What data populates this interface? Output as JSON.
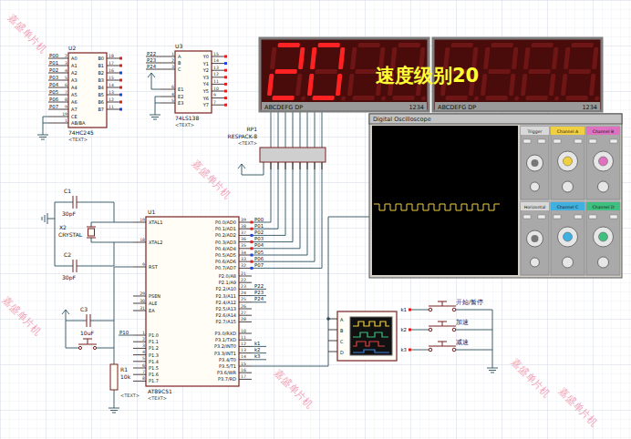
{
  "u2": {
    "ref": "U2",
    "part": "74HC245",
    "note": "<TEXT>",
    "left_pins": [
      {
        "net": "P00",
        "num": "2",
        "name": "A0"
      },
      {
        "net": "P01",
        "num": "3",
        "name": "A1"
      },
      {
        "net": "P02",
        "num": "4",
        "name": "A2"
      },
      {
        "net": "P03",
        "num": "5",
        "name": "A3"
      },
      {
        "net": "P04",
        "num": "6",
        "name": "A4"
      },
      {
        "net": "P05",
        "num": "7",
        "name": "A5"
      },
      {
        "net": "P06",
        "num": "8",
        "name": "A6"
      },
      {
        "net": "P07",
        "num": "9",
        "name": "A7"
      }
    ],
    "right_pins": [
      {
        "name": "B0",
        "num": "18",
        "high": true
      },
      {
        "name": "B1",
        "num": "17",
        "high": true
      },
      {
        "name": "B2",
        "num": "16",
        "high": false
      },
      {
        "name": "B3",
        "num": "15",
        "high": true
      },
      {
        "name": "B4",
        "num": "14",
        "high": true
      },
      {
        "name": "B5",
        "num": "13",
        "high": false
      },
      {
        "name": "B6",
        "num": "12",
        "high": true
      },
      {
        "name": "B7",
        "num": "11",
        "high": false
      }
    ],
    "ctrl_pins": [
      {
        "name": "CE",
        "num": "19"
      },
      {
        "name": "AB/BA",
        "num": "1"
      }
    ]
  },
  "u3": {
    "ref": "U3",
    "part": "74LS138",
    "note": "<TEXT>",
    "select_pins": [
      {
        "net": "P22",
        "num": "1",
        "name": "A"
      },
      {
        "net": "P23",
        "num": "2",
        "name": "B"
      },
      {
        "net": "P24",
        "num": "3",
        "name": "C"
      }
    ],
    "enable_pins": [
      {
        "name": "E1",
        "num": "6"
      },
      {
        "name": "E2",
        "num": "4"
      },
      {
        "name": "E3",
        "num": "5"
      }
    ],
    "right_pins": [
      {
        "name": "Y0",
        "num": "15",
        "high": true
      },
      {
        "name": "Y1",
        "num": "14",
        "high": false
      },
      {
        "name": "Y2",
        "num": "13",
        "high": true
      },
      {
        "name": "Y3",
        "num": "12",
        "high": true
      },
      {
        "name": "Y4",
        "num": "11",
        "high": true
      },
      {
        "name": "Y5",
        "num": "10",
        "high": true
      },
      {
        "name": "Y6",
        "num": "9",
        "high": true
      },
      {
        "name": "Y7",
        "num": "7",
        "high": true
      }
    ]
  },
  "display": {
    "overlay": "速度级别20",
    "modules": [
      {
        "digits": [
          "2",
          "0",
          "",
          ""
        ],
        "segment_pins": "ABCDEFG  DP",
        "digit_pins": "1234"
      },
      {
        "digits": [
          "",
          "",
          "",
          ""
        ],
        "segment_pins": "ABCDEFG  DP",
        "digit_pins": "1234"
      }
    ]
  },
  "rp1": {
    "ref": "RP1",
    "part": "RESPACK-8",
    "note": "<TEXT>"
  },
  "u1": {
    "ref": "U1",
    "part": "AT89C51",
    "note": "<TEXT>",
    "left_pins": [
      {
        "name": "XTAL1",
        "num": "19"
      },
      {
        "name": "XTAL2",
        "num": "18"
      },
      {
        "name": "RST",
        "num": "9"
      },
      {
        "name": "PSEN",
        "num": "29"
      },
      {
        "name": "ALE",
        "num": "30"
      },
      {
        "name": "EA",
        "num": "31"
      }
    ],
    "port_p1": [
      {
        "name": "P1.0",
        "num": "1",
        "net": "P10"
      },
      {
        "name": "P1.1",
        "num": "2"
      },
      {
        "name": "P1.2",
        "num": "3"
      },
      {
        "name": "P1.3",
        "num": "4"
      },
      {
        "name": "P1.4",
        "num": "5"
      },
      {
        "name": "P1.5",
        "num": "6"
      },
      {
        "name": "P1.6",
        "num": "7"
      },
      {
        "name": "P1.7",
        "num": "8"
      }
    ],
    "port_p0": [
      {
        "name": "P0.0/AD0",
        "num": "39",
        "net": "P00",
        "high": true
      },
      {
        "name": "P0.1/AD1",
        "num": "38",
        "net": "P01",
        "high": true
      },
      {
        "name": "P0.2/AD2",
        "num": "37",
        "net": "P02",
        "high": false
      },
      {
        "name": "P0.3/AD3",
        "num": "36",
        "net": "P03",
        "high": true
      },
      {
        "name": "P0.4/AD4",
        "num": "35",
        "net": "P04",
        "high": true
      },
      {
        "name": "P0.5/AD5",
        "num": "34",
        "net": "P05",
        "high": false
      },
      {
        "name": "P0.6/AD6",
        "num": "33",
        "net": "P06",
        "high": true
      },
      {
        "name": "P0.7/AD7",
        "num": "32",
        "net": "P07",
        "high": false
      }
    ],
    "port_p2": [
      {
        "name": "P2.0/A8",
        "num": "21"
      },
      {
        "name": "P2.1/A9",
        "num": "22"
      },
      {
        "name": "P2.2/A10",
        "num": "23",
        "net": "P22"
      },
      {
        "name": "P2.3/A11",
        "num": "24",
        "net": "P23"
      },
      {
        "name": "P2.4/A12",
        "num": "25",
        "net": "P24"
      },
      {
        "name": "P2.5/A13",
        "num": "26"
      },
      {
        "name": "P2.6/A14",
        "num": "27"
      },
      {
        "name": "P2.7/A15",
        "num": "28"
      }
    ],
    "port_p3": [
      {
        "name": "P3.0/RXD",
        "num": "10"
      },
      {
        "name": "P3.1/TXD",
        "num": "11"
      },
      {
        "name": "P3.2/INT0",
        "num": "12",
        "net": "k1"
      },
      {
        "name": "P3.3/INT1",
        "num": "13",
        "net": "k2"
      },
      {
        "name": "P3.4/T0",
        "num": "14",
        "net": "k3"
      },
      {
        "name": "P3.5/T1",
        "num": "15"
      },
      {
        "name": "P3.6/WR",
        "num": "16"
      },
      {
        "name": "P3.7/RD",
        "num": "17"
      }
    ]
  },
  "crystal": {
    "c1": {
      "ref": "C1",
      "value": "30pF"
    },
    "c2": {
      "ref": "C2",
      "value": "30pF"
    },
    "x2": {
      "ref": "X2",
      "value": "CRYSTAL"
    }
  },
  "reset": {
    "c3": {
      "ref": "C3",
      "value": "10uF"
    },
    "r1": {
      "ref": "R1",
      "value": "10k",
      "note": "<TEXT>"
    }
  },
  "oscilloscope": {
    "title": "Digital Oscilloscope",
    "channels": [
      {
        "label": "Channel A",
        "color": "#f0d040"
      },
      {
        "label": "Channel B",
        "color": "#e070c0"
      },
      {
        "label": "Channel C",
        "color": "#40b0e0"
      },
      {
        "label": "Channel D",
        "color": "#40c080"
      }
    ],
    "sections": [
      "Trigger",
      "Horizontal"
    ],
    "trace": [
      1,
      0,
      1,
      0,
      1,
      0,
      1,
      0,
      1,
      0,
      1,
      0,
      1,
      0,
      1,
      0,
      1,
      0,
      1,
      0,
      1,
      0,
      1
    ]
  },
  "logic_analyzer": {
    "inputs": [
      "A",
      "B",
      "C",
      "D"
    ]
  },
  "switches": [
    {
      "ref": "k1",
      "label": "开始/暂停"
    },
    {
      "ref": "k2",
      "label": "加速"
    },
    {
      "ref": "k3",
      "label": "减速"
    }
  ],
  "watermarks": [
    "嘉盛单片机",
    "嘉盛单片机",
    "嘉盛单片机",
    "嘉盛单片机",
    "嘉盛单片机",
    "嘉盛单片机"
  ]
}
